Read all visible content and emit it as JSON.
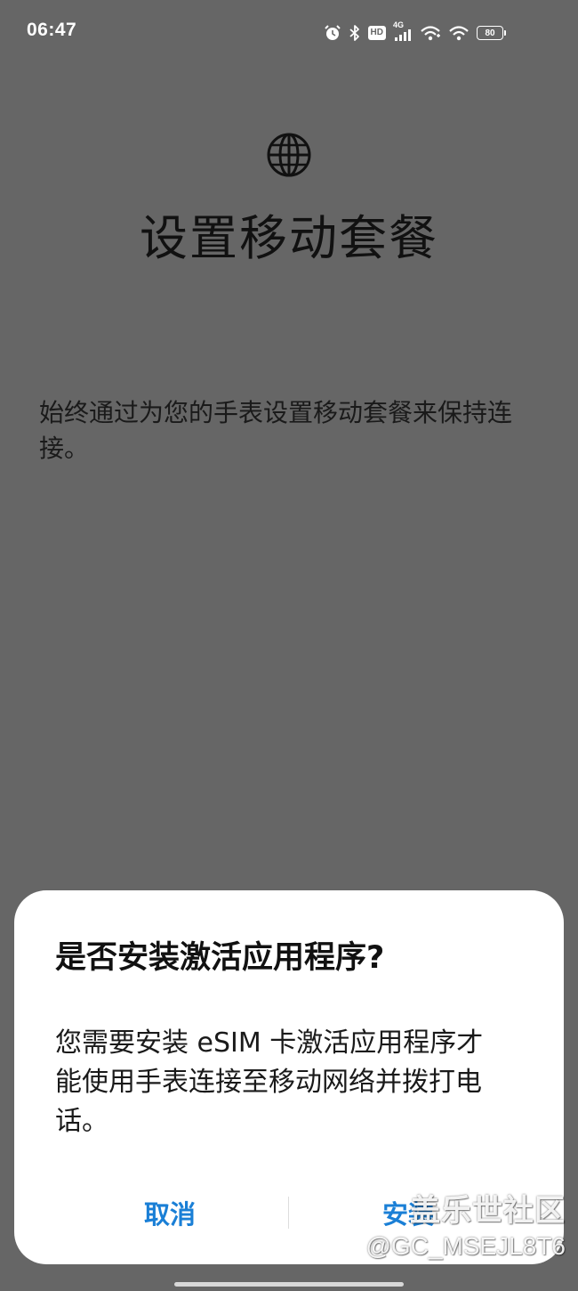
{
  "status_bar": {
    "time": "06:47",
    "hd_label": "HD",
    "network_label": "4G",
    "battery_level": "80"
  },
  "page": {
    "icon": "globe-icon",
    "title": "设置移动套餐",
    "description": "始终通过为您的手表设置移动套餐来保持连接。"
  },
  "dialog": {
    "title": "是否安装激活应用程序?",
    "body": "您需要安装 eSIM 卡激活应用程序才能使用手表连接至移动网络并拨打电话。",
    "cancel_label": "取消",
    "install_label": "安装"
  },
  "watermark": {
    "line1": "盖乐世社区",
    "line2": "@GC_MSEJL8T6"
  },
  "colors": {
    "background": "#666666",
    "accent": "#1a7fd6",
    "dialog_bg": "#ffffff"
  }
}
